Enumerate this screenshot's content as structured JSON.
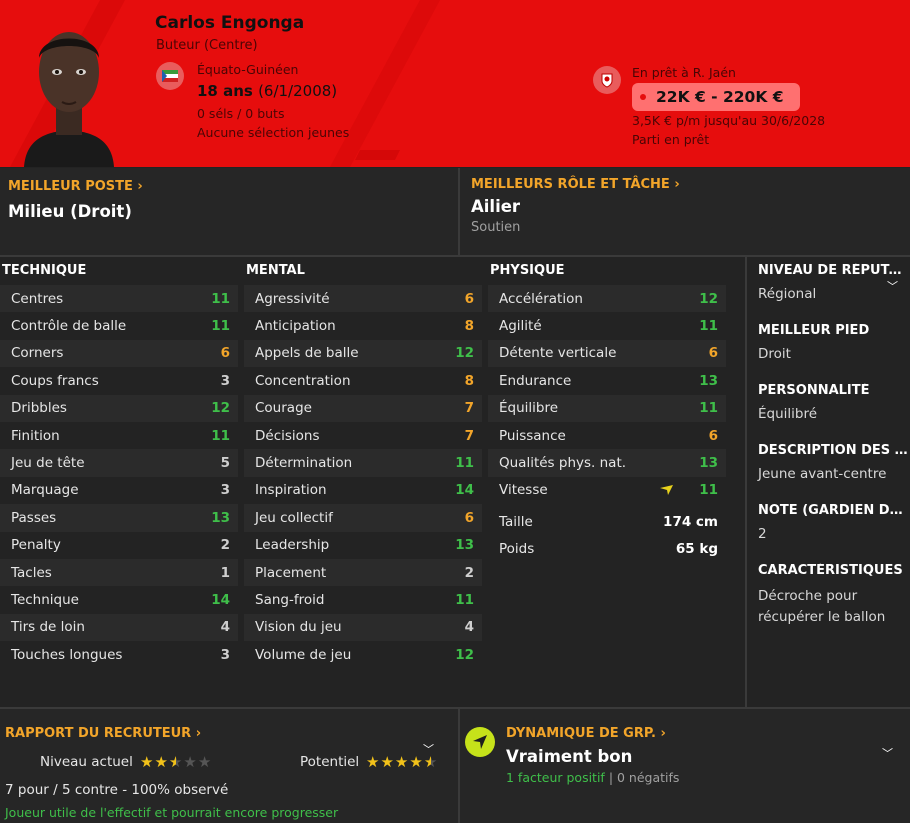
{
  "player": {
    "name": "Carlos Engonga",
    "position": "Buteur (Centre)",
    "nationality": "Équato-Guinéen",
    "age": "18 ans",
    "dob": "(6/1/2008)",
    "caps": "0 séls / 0 buts",
    "youth_caps": "Aucune sélection jeunes",
    "loan_at": "En prêt à R. Jaén",
    "value": "22K € - 220K €",
    "wage": "3,5K € p/m jusqu'au 30/6/2028",
    "loan_status": "Parti en prêt"
  },
  "best_position": {
    "label": "MEILLEUR POSTE",
    "value": "Milieu (Droit)"
  },
  "best_role": {
    "label": "MEILLEURS RÔLE ET TÂCHE",
    "value": "Ailier",
    "duty": "Soutien"
  },
  "technique": {
    "title": "TECHNIQUE",
    "rows": [
      {
        "name": "Centres",
        "value": "11",
        "tier": "g"
      },
      {
        "name": "Contrôle de balle",
        "value": "11",
        "tier": "g"
      },
      {
        "name": "Corners",
        "value": "6",
        "tier": "o"
      },
      {
        "name": "Coups francs",
        "value": "3",
        "tier": "w"
      },
      {
        "name": "Dribbles",
        "value": "12",
        "tier": "g"
      },
      {
        "name": "Finition",
        "value": "11",
        "tier": "g"
      },
      {
        "name": "Jeu de tête",
        "value": "5",
        "tier": "w"
      },
      {
        "name": "Marquage",
        "value": "3",
        "tier": "w"
      },
      {
        "name": "Passes",
        "value": "13",
        "tier": "g"
      },
      {
        "name": "Penalty",
        "value": "2",
        "tier": "w"
      },
      {
        "name": "Tacles",
        "value": "1",
        "tier": "w"
      },
      {
        "name": "Technique",
        "value": "14",
        "tier": "g"
      },
      {
        "name": "Tirs de loin",
        "value": "4",
        "tier": "w"
      },
      {
        "name": "Touches longues",
        "value": "3",
        "tier": "w"
      }
    ]
  },
  "mental": {
    "title": "MENTAL",
    "rows": [
      {
        "name": "Agressivité",
        "value": "6",
        "tier": "o"
      },
      {
        "name": "Anticipation",
        "value": "8",
        "tier": "o"
      },
      {
        "name": "Appels de balle",
        "value": "12",
        "tier": "g"
      },
      {
        "name": "Concentration",
        "value": "8",
        "tier": "o"
      },
      {
        "name": "Courage",
        "value": "7",
        "tier": "o"
      },
      {
        "name": "Décisions",
        "value": "7",
        "tier": "o"
      },
      {
        "name": "Détermination",
        "value": "11",
        "tier": "g"
      },
      {
        "name": "Inspiration",
        "value": "14",
        "tier": "g"
      },
      {
        "name": "Jeu collectif",
        "value": "6",
        "tier": "o"
      },
      {
        "name": "Leadership",
        "value": "13",
        "tier": "g"
      },
      {
        "name": "Placement",
        "value": "2",
        "tier": "w"
      },
      {
        "name": "Sang-froid",
        "value": "11",
        "tier": "g"
      },
      {
        "name": "Vision du jeu",
        "value": "4",
        "tier": "w"
      },
      {
        "name": "Volume de jeu",
        "value": "12",
        "tier": "g"
      }
    ]
  },
  "physique": {
    "title": "PHYSIQUE",
    "rows": [
      {
        "name": "Accélération",
        "value": "12",
        "tier": "g"
      },
      {
        "name": "Agilité",
        "value": "11",
        "tier": "g"
      },
      {
        "name": "Détente verticale",
        "value": "6",
        "tier": "o"
      },
      {
        "name": "Endurance",
        "value": "13",
        "tier": "g"
      },
      {
        "name": "Équilibre",
        "value": "11",
        "tier": "g"
      },
      {
        "name": "Puissance",
        "value": "6",
        "tier": "o"
      },
      {
        "name": "Qualités phys. nat.",
        "value": "13",
        "tier": "g"
      },
      {
        "name": "Vitesse",
        "value": "11",
        "tier": "g"
      }
    ],
    "height_label": "Taille",
    "height": "174 cm",
    "weight_label": "Poids",
    "weight": "65 kg"
  },
  "side": {
    "reputation_title": "NIVEAU DE RÉPUTATION",
    "reputation": "Régional",
    "foot_title": "MEILLEUR PIED",
    "foot": "Droit",
    "personality_title": "PERSONNALITÉ",
    "personality": "Équilibré",
    "description_title": "DESCRIPTION DES MÉDIAS",
    "description": "Jeune avant-centre",
    "gk_title": "NOTE (GARDIEN DE BUT)",
    "gk": "2",
    "traits_title": "CARACTÉRISTIQUES",
    "traits": "Décroche pour récupérer le ballon"
  },
  "scout": {
    "label": "RAPPORT DU RECRUTEUR",
    "current_label": "Niveau actuel",
    "current_stars": 2.5,
    "potential_label": "Potentiel",
    "potential_stars": 4.5,
    "pros_cons": "7 pour / 5 contre - 100% observé",
    "summary": "Joueur utile de l'effectif et pourrait encore progresser"
  },
  "dynamics": {
    "label": "DYNAMIQUE DE GRP.",
    "value": "Vraiment bon",
    "positive": "1 facteur positif",
    "negative": "0 négatifs"
  },
  "colors": {
    "header": "#e60d0d",
    "accent": "#f2a52a",
    "good": "#3fbf4a"
  }
}
